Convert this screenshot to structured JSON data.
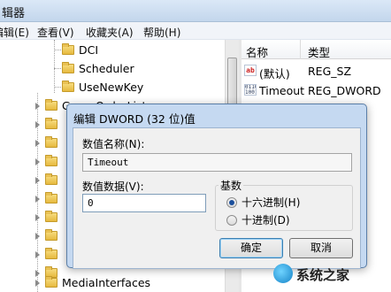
{
  "window": {
    "title": "辑器"
  },
  "menu": [
    "编辑(E)",
    "查看(V)",
    "收藏夹(A)",
    "帮助(H)"
  ],
  "tree": {
    "items": [
      {
        "label": "DCI",
        "expandable": false
      },
      {
        "label": "Scheduler",
        "expandable": false
      },
      {
        "label": "UseNewKey",
        "expandable": false
      },
      {
        "label": "GroupOrderList",
        "expandable": true
      },
      {
        "label": "MediaInterfaces",
        "expandable": true
      }
    ]
  },
  "list": {
    "headers": [
      "名称",
      "类型"
    ],
    "rows": [
      {
        "name": "(默认)",
        "type": "REG_SZ",
        "icon": "string-value-icon"
      },
      {
        "name": "Timeout",
        "type": "REG_DWORD",
        "icon": "binary-value-icon"
      }
    ]
  },
  "dialog": {
    "title": "编辑 DWORD (32 位)值",
    "value_name_label": "数值名称(N):",
    "value_name": "Timeout",
    "value_data_label": "数值数据(V):",
    "value_data": "0",
    "base_label": "基数",
    "base_options": [
      {
        "label": "十六进制(H)",
        "selected": true
      },
      {
        "label": "十进制(D)",
        "selected": false
      }
    ],
    "ok_label": "确定",
    "cancel_label": "取消"
  },
  "watermark": {
    "text": "系统之家"
  }
}
